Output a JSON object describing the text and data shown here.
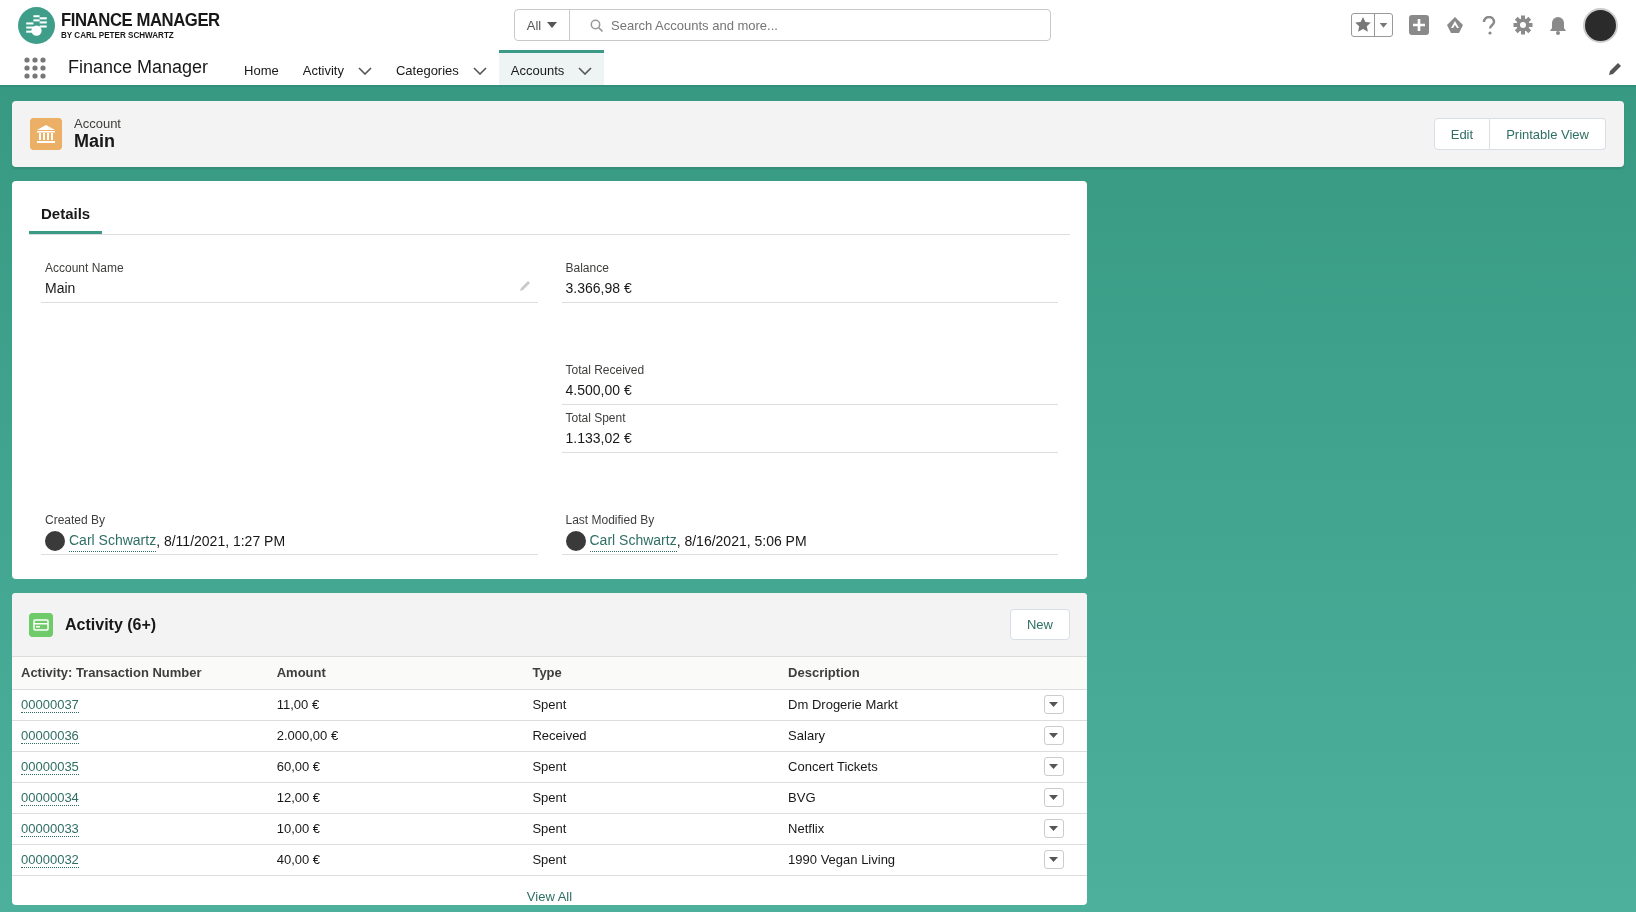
{
  "header": {
    "logo_title": "FINANCE MANAGER",
    "logo_subtitle": "BY CARL PETER SCHWARTZ",
    "search_scope": "All",
    "search_placeholder": "Search Accounts and more..."
  },
  "nav": {
    "app_name": "Finance Manager",
    "items": [
      {
        "label": "Home",
        "selected": false,
        "has_menu": false
      },
      {
        "label": "Activity",
        "selected": false,
        "has_menu": true
      },
      {
        "label": "Categories",
        "selected": false,
        "has_menu": true
      },
      {
        "label": "Accounts",
        "selected": true,
        "has_menu": true
      }
    ]
  },
  "record": {
    "object_type": "Account",
    "name": "Main",
    "buttons": [
      "Edit",
      "Printable View"
    ]
  },
  "details": {
    "tabs": [
      {
        "label": "Details",
        "selected": true
      }
    ],
    "sections": [
      {
        "rows": [
          [
            {
              "kind": "text",
              "label": "Account Name",
              "value": "Main",
              "editable": true
            },
            {
              "kind": "text",
              "label": "Balance",
              "value": "3.366,98 €",
              "editable": false
            }
          ]
        ]
      },
      {
        "rows": [
          [
            null,
            {
              "kind": "text",
              "label": "Total Received",
              "value": "4.500,00 €",
              "editable": false
            }
          ],
          [
            null,
            {
              "kind": "text",
              "label": "Total Spent",
              "value": "1.133,02 €",
              "editable": false
            }
          ]
        ]
      },
      {
        "rows": [
          [
            {
              "kind": "user",
              "label": "Created By",
              "user": "Carl Schwartz",
              "stamp": ", 8/11/2021, 1:27 PM"
            },
            {
              "kind": "user",
              "label": "Last Modified By",
              "user": "Carl Schwartz",
              "stamp": ", 8/16/2021, 5:06 PM"
            }
          ]
        ]
      }
    ]
  },
  "activity": {
    "title": "Activity (6+)",
    "new_button": "New",
    "columns": [
      "Activity: Transaction Number",
      "Amount",
      "Type",
      "Description"
    ],
    "rows": [
      {
        "number": "00000037",
        "amount": "11,00 €",
        "type": "Spent",
        "description": "Dm Drogerie Markt"
      },
      {
        "number": "00000036",
        "amount": "2.000,00 €",
        "type": "Received",
        "description": "Salary"
      },
      {
        "number": "00000035",
        "amount": "60,00 €",
        "type": "Spent",
        "description": "Concert Tickets"
      },
      {
        "number": "00000034",
        "amount": "12,00 €",
        "type": "Spent",
        "description": "BVG"
      },
      {
        "number": "00000033",
        "amount": "10,00 €",
        "type": "Spent",
        "description": "Netflix"
      },
      {
        "number": "00000032",
        "amount": "40,00 €",
        "type": "Spent",
        "description": "1990 Vegan Living"
      }
    ],
    "view_all": "View All"
  }
}
